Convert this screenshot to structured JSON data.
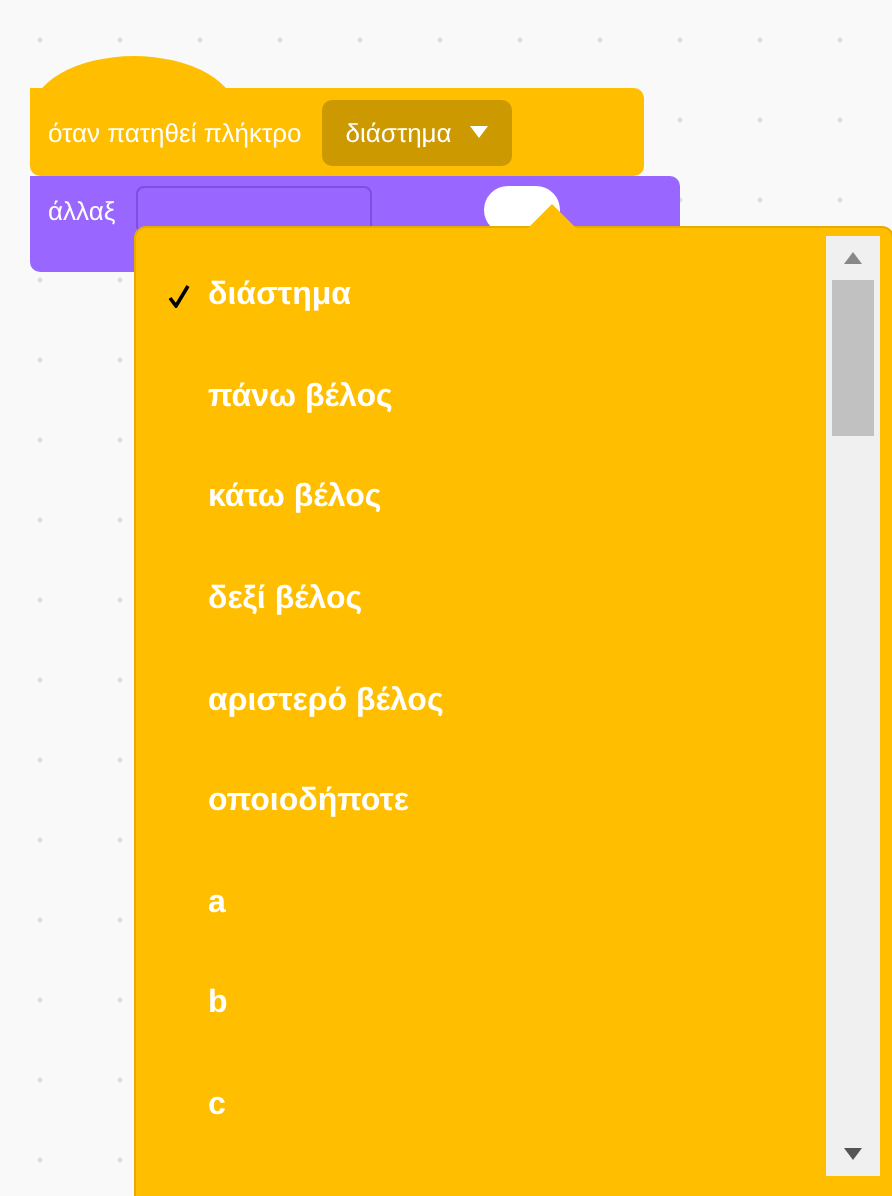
{
  "hat_block": {
    "label": "όταν πατηθεί πλήκτρο",
    "dropdown": "διάστημα"
  },
  "stack_block": {
    "label": "άλλαξ"
  },
  "menu": {
    "items": [
      {
        "label": "διάστημα",
        "selected": true
      },
      {
        "label": "πάνω βέλος",
        "selected": false
      },
      {
        "label": "κάτω βέλος",
        "selected": false
      },
      {
        "label": "δεξί βέλος",
        "selected": false
      },
      {
        "label": "αριστερό βέλος",
        "selected": false
      },
      {
        "label": "οποιοδήποτε",
        "selected": false
      },
      {
        "label": "a",
        "selected": false
      },
      {
        "label": "b",
        "selected": false
      },
      {
        "label": "c",
        "selected": false
      }
    ]
  }
}
